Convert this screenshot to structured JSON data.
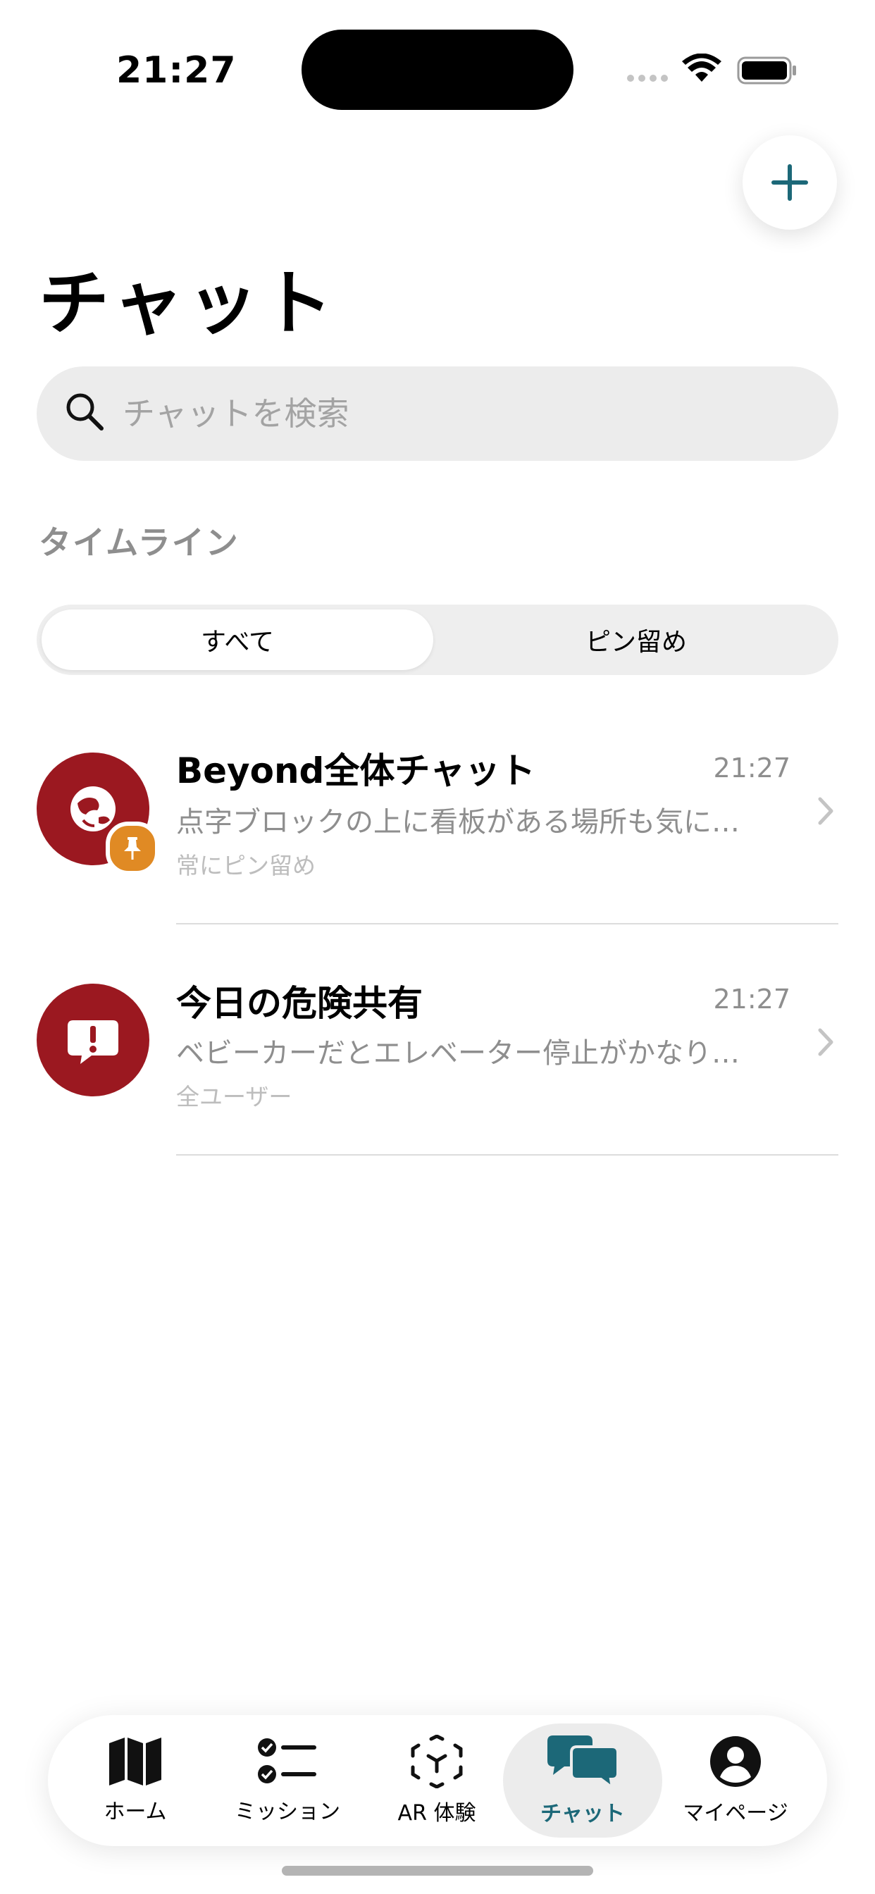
{
  "status_bar": {
    "time": "21:27"
  },
  "header": {
    "title": "チャット"
  },
  "search": {
    "placeholder": "チャットを検索"
  },
  "section": {
    "label": "タイムライン"
  },
  "filter": {
    "options": [
      "すべて",
      "ピン留め"
    ],
    "selected": "すべて"
  },
  "chats": [
    {
      "name": "Beyond全体チャット",
      "time": "21:27",
      "preview": "点字ブロックの上に看板がある場所も気に…",
      "meta": "常にピン留め",
      "pinned": true
    },
    {
      "name": "今日の危険共有",
      "time": "21:27",
      "preview": "ベビーカーだとエレベーター停止がかなり…",
      "meta": "全ユーザー",
      "pinned": false
    }
  ],
  "tabbar": {
    "items": [
      {
        "label": "ホーム",
        "icon": "map-icon"
      },
      {
        "label": "ミッション",
        "icon": "checklist-icon"
      },
      {
        "label": "AR 体験",
        "icon": "ar-cube-icon"
      },
      {
        "label": "チャット",
        "icon": "chat-bubbles-icon"
      },
      {
        "label": "マイページ",
        "icon": "person-icon"
      }
    ],
    "active": "チャット"
  },
  "colors": {
    "accent": "#1c6878",
    "avatar": "#9b1820",
    "pin_badge": "#e08a24"
  }
}
